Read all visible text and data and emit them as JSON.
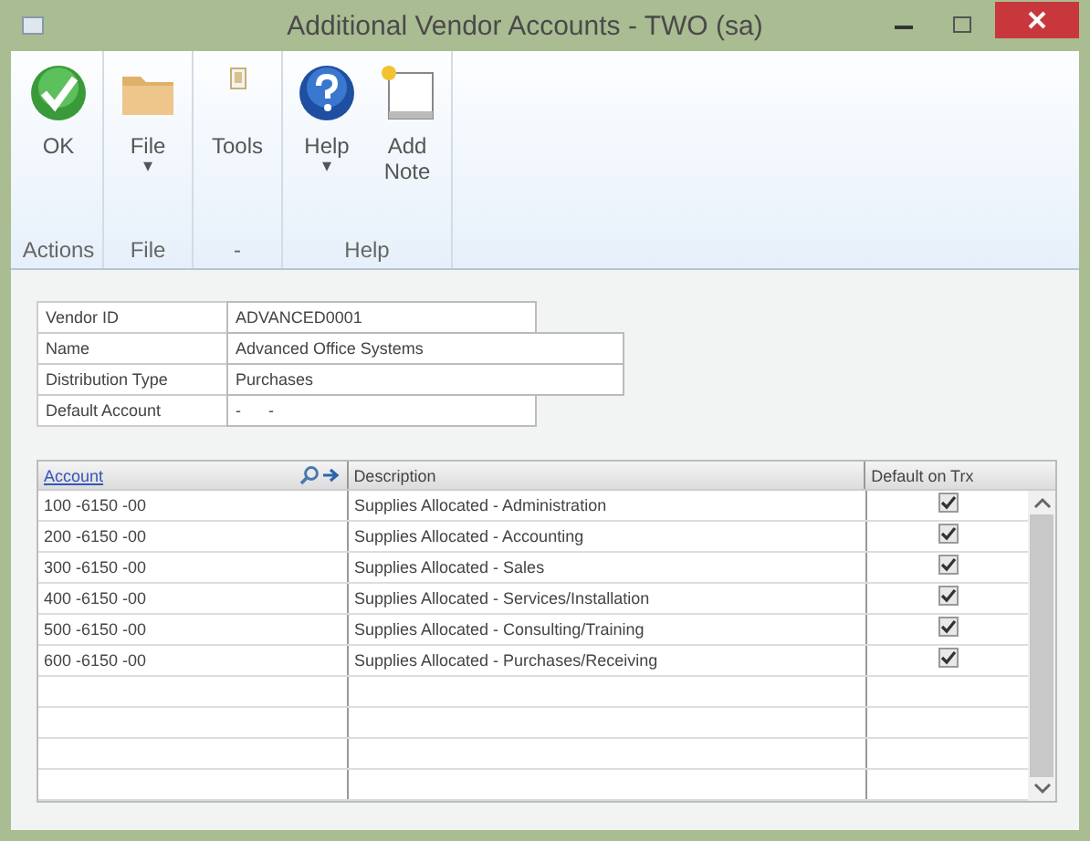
{
  "window": {
    "title": "Additional Vendor Accounts  -  TWO (sa)"
  },
  "ribbon": {
    "groups": [
      {
        "label": "Actions",
        "buttons": [
          {
            "kind": "ok",
            "label": "OK"
          }
        ]
      },
      {
        "label": "File",
        "buttons": [
          {
            "kind": "folder",
            "label": "File",
            "caret": "▾"
          }
        ]
      },
      {
        "label": "-",
        "buttons": [
          {
            "kind": "tools",
            "label": "Tools"
          }
        ]
      },
      {
        "label": "Help",
        "buttons": [
          {
            "kind": "help",
            "label": "Help",
            "caret": "▾"
          },
          {
            "kind": "note",
            "label": "Add Note"
          }
        ]
      }
    ]
  },
  "fields": [
    {
      "label": "Vendor ID",
      "value": "ADVANCED0001"
    },
    {
      "label": "Name",
      "value": "Advanced Office Systems"
    },
    {
      "label": "Distribution Type",
      "value": "Purchases"
    },
    {
      "label": "Default Account",
      "value": "-      -"
    }
  ],
  "table": {
    "columns": [
      "Account",
      "Description",
      "Default on Trx"
    ],
    "rows": [
      {
        "account": "100 -6150 -00",
        "description": "Supplies Allocated - Administration",
        "checked": true
      },
      {
        "account": "200 -6150 -00",
        "description": "Supplies Allocated - Accounting",
        "checked": true
      },
      {
        "account": "300 -6150 -00",
        "description": "Supplies Allocated - Sales",
        "checked": true
      },
      {
        "account": "400 -6150 -00",
        "description": "Supplies Allocated - Services/Installation",
        "checked": true
      },
      {
        "account": "500 -6150 -00",
        "description": "Supplies Allocated - Consulting/Training",
        "checked": true
      },
      {
        "account": "600 -6150 -00",
        "description": "Supplies Allocated - Purchases/Receiving",
        "checked": true
      }
    ]
  }
}
